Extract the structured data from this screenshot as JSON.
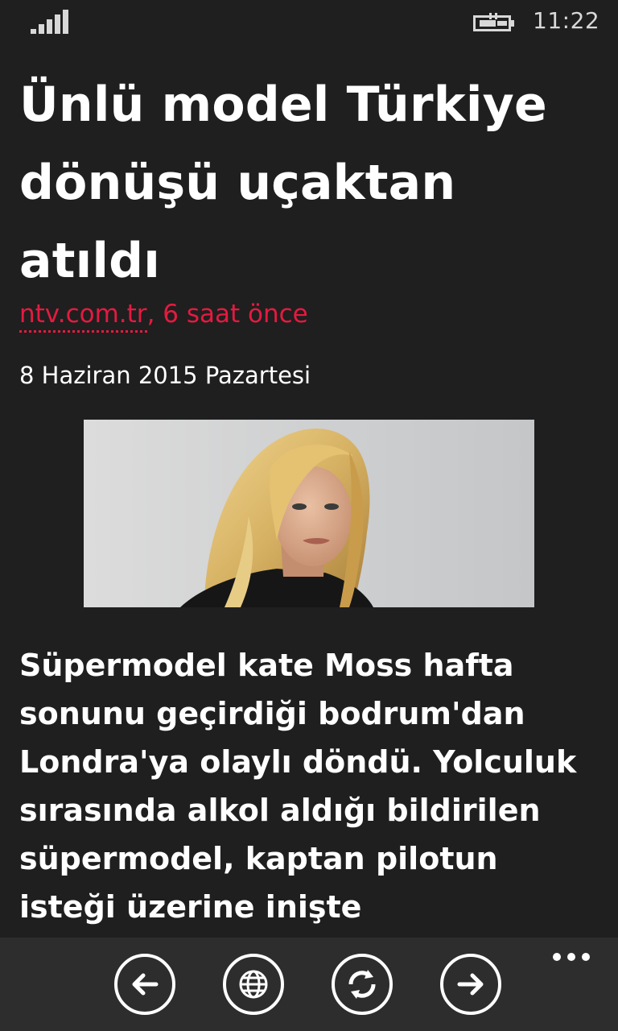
{
  "status_bar": {
    "signal_icon": "signal-strength-icon",
    "battery_icon": "battery-charging-icon",
    "time": "11:22"
  },
  "article": {
    "title": "Ünlü model Türkiye dönüşü uçaktan atıldı",
    "source": "ntv.com.tr",
    "separator": ", ",
    "published_ago": "6 saat önce",
    "date": "8 Haziran 2015 Pazartesi",
    "body": "Süpermodel kate Moss hafta sonunu geçirdiği bodrum'dan Londra'ya olaylı döndü. Yolculuk sırasında alkol aldığı bildirilen süpermodel, kaptan pilotun isteği üzerine inişte"
  },
  "app_bar": {
    "buttons": [
      {
        "icon": "back-arrow-icon"
      },
      {
        "icon": "globe-icon"
      },
      {
        "icon": "refresh-icon"
      },
      {
        "icon": "forward-arrow-icon"
      }
    ],
    "more_icon": "more-dots-icon"
  },
  "colors": {
    "background": "#1f1f1f",
    "accent": "#e51a40",
    "app_bar": "#2d2d2d",
    "text": "#ffffff"
  }
}
